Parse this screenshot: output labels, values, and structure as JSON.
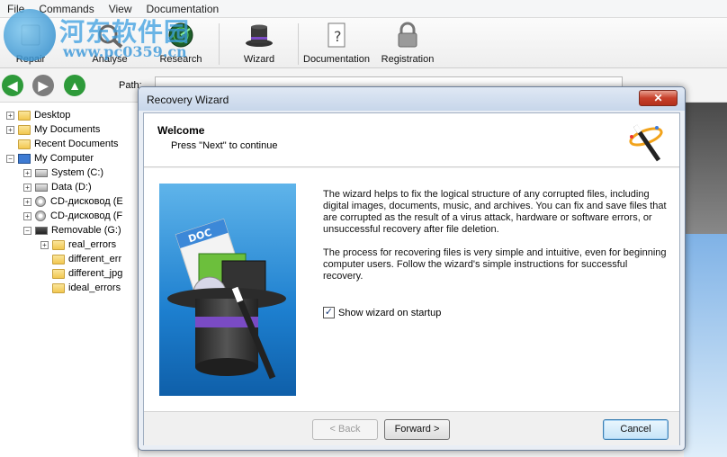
{
  "menu": [
    "File",
    "Commands",
    "View",
    "Documentation"
  ],
  "watermark": {
    "text": "河东软件园",
    "url": "www.pc0359.cn"
  },
  "toolbar": {
    "repair": "Repair",
    "analyse": "Analyse",
    "research": "Research",
    "wizard": "Wizard",
    "documentation": "Documentation",
    "registration": "Registration"
  },
  "nav": {
    "path_label": "Path:"
  },
  "tree": {
    "desktop": "Desktop",
    "my_documents": "My Documents",
    "recent_documents": "Recent Documents",
    "my_computer": "My Computer",
    "system": "System (C:)",
    "data": "Data (D:)",
    "cd1": "CD-дисковод (E",
    "cd2": "CD-дисковод (F",
    "removable": "Removable (G:)",
    "real_errors": "real_errors",
    "different_err": "different_err",
    "different_jpg": "different_jpg",
    "ideal_errors": "ideal_errors"
  },
  "dialog": {
    "title": "Recovery Wizard",
    "close": "✕",
    "header_title": "Welcome",
    "header_sub": "Press \"Next\" to continue",
    "banner_label": "DOC",
    "para1": "The wizard helps to fix the logical structure of any corrupted files, including digital images, documents, music, and archives. You can fix and save files that are corrupted as the result of a virus attack, hardware or software errors, or unsuccessful recovery after file deletion.",
    "para2": "The process for recovering files is very simple and intuitive, even for beginning computer users. Follow the wizard's simple instructions for successful recovery.",
    "checkbox_label": "Show wizard on startup",
    "checkbox_checked": true,
    "back": "< Back",
    "forward": "Forward >",
    "cancel": "Cancel"
  },
  "colors": {
    "nav_green": "#2e9a3a",
    "nav_gray": "#7d7d7d",
    "accent": "#3c7fb1"
  }
}
